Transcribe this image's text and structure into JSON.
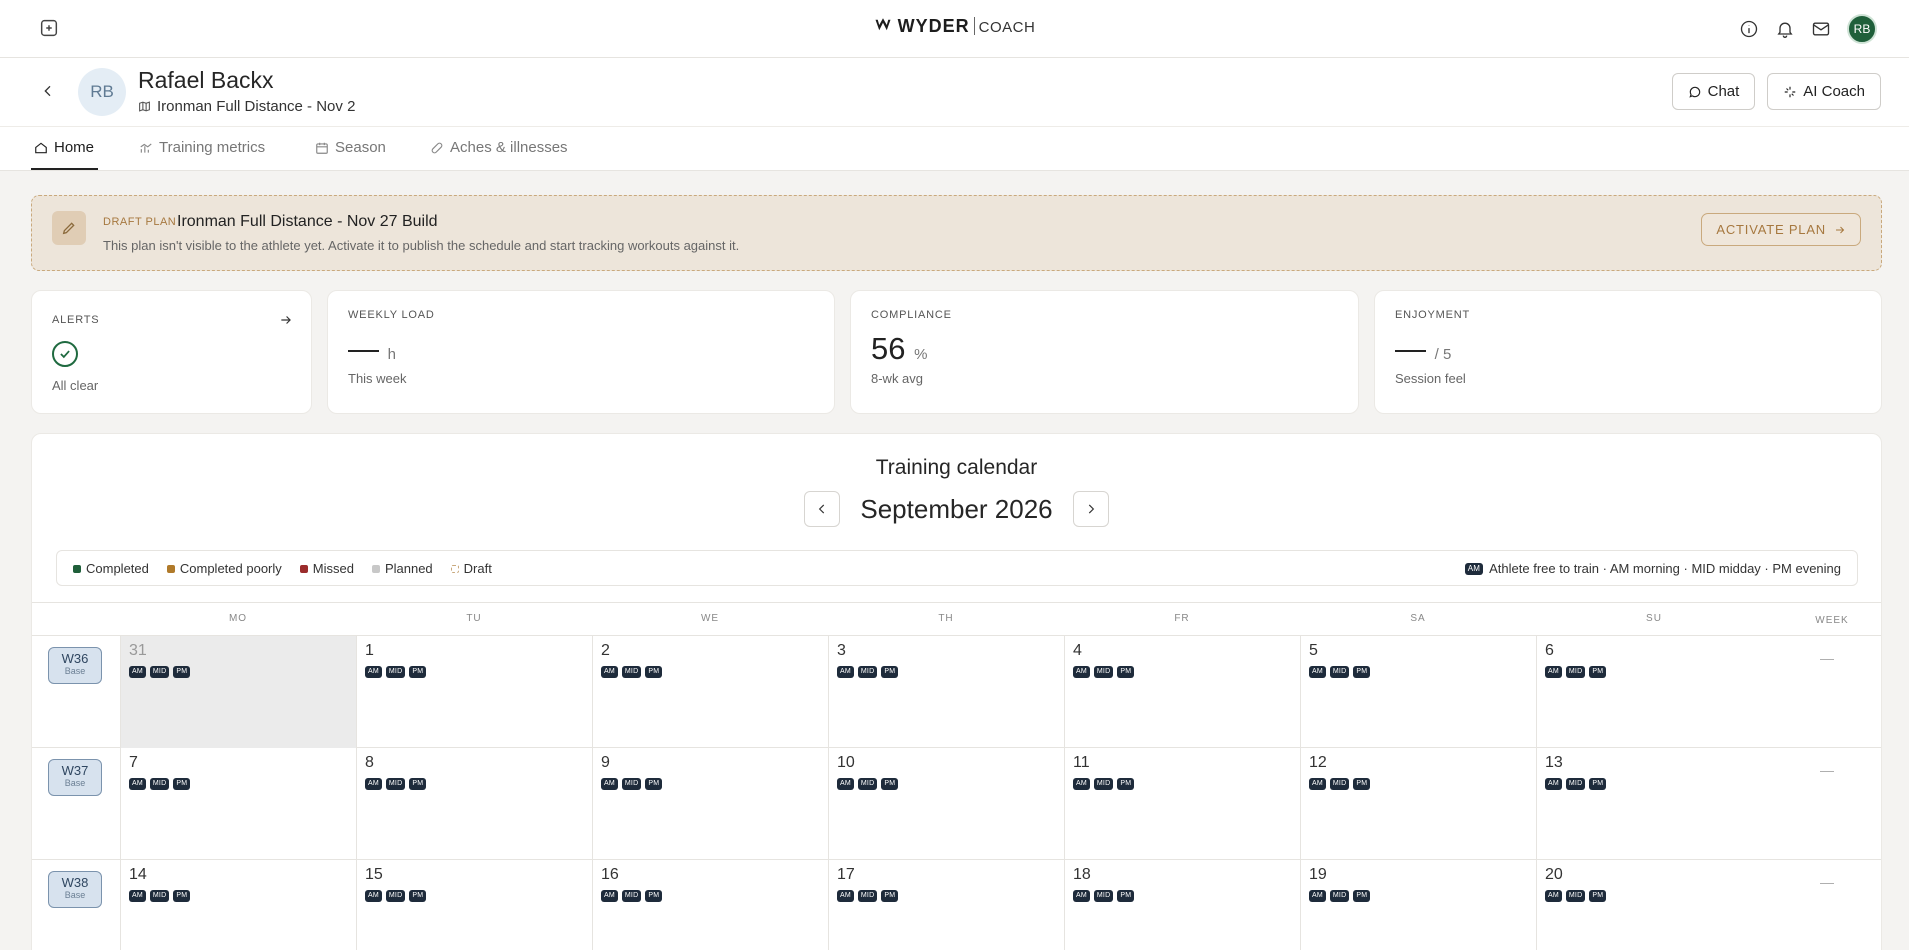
{
  "topbar": {
    "brand": "WYDER",
    "product": "COACH",
    "avatar_initials": "RB"
  },
  "athlete": {
    "initials": "RB",
    "name": "Rafael Backx",
    "event": "Ironman Full Distance - Nov 2",
    "chat_label": "Chat",
    "ai_coach_label": "AI Coach"
  },
  "tabs": [
    {
      "label": "Home"
    },
    {
      "label": "Training metrics"
    },
    {
      "label": "Season"
    },
    {
      "label": "Aches & illnesses"
    }
  ],
  "banner": {
    "tag": "DRAFT PLAN",
    "title": "Ironman Full Distance - Nov 27 Build",
    "description": "This plan isn't visible to the athlete yet. Activate it to publish the schedule and start tracking workouts against it.",
    "action_label": "ACTIVATE PLAN"
  },
  "cards": {
    "alerts": {
      "label": "ALERTS",
      "sub": "All clear"
    },
    "weekly_load": {
      "label": "WEEKLY LOAD",
      "value": "—",
      "unit": "h",
      "sub": "This week"
    },
    "compliance": {
      "label": "COMPLIANCE",
      "value": "56",
      "unit": "%",
      "sub": "8-wk avg"
    },
    "enjoyment": {
      "label": "ENJOYMENT",
      "value": "—",
      "unit": "/ 5",
      "sub": "Session feel"
    }
  },
  "calendar": {
    "title": "Training calendar",
    "month": "September 2026",
    "legend": [
      {
        "label": "Completed",
        "color": "#1f5f3a"
      },
      {
        "label": "Completed poorly",
        "color": "#b07a2a"
      },
      {
        "label": "Missed",
        "color": "#9b2c2c"
      },
      {
        "label": "Planned",
        "color": "#c8c8c8"
      },
      {
        "label": "Draft",
        "color": "#c9a97d"
      }
    ],
    "legend_right_badge": "AM",
    "legend_right_text": "Athlete free to train · AM morning · MID midday · PM evening",
    "days_of_week": [
      "MO",
      "TU",
      "WE",
      "TH",
      "FR",
      "SA",
      "SU"
    ],
    "week_header": "WEEK",
    "slots": [
      "AM",
      "MID",
      "PM"
    ],
    "weeks": [
      {
        "label": "W36",
        "phase": "Base",
        "total": "—",
        "days": [
          "31",
          "1",
          "2",
          "3",
          "4",
          "5",
          "6"
        ],
        "first_out_of_month": true
      },
      {
        "label": "W37",
        "phase": "Base",
        "total": "—",
        "days": [
          "7",
          "8",
          "9",
          "10",
          "11",
          "12",
          "13"
        ],
        "first_out_of_month": false
      },
      {
        "label": "W38",
        "phase": "Base",
        "total": "—",
        "days": [
          "14",
          "15",
          "16",
          "17",
          "18",
          "19",
          "20"
        ],
        "first_out_of_month": false
      }
    ]
  }
}
